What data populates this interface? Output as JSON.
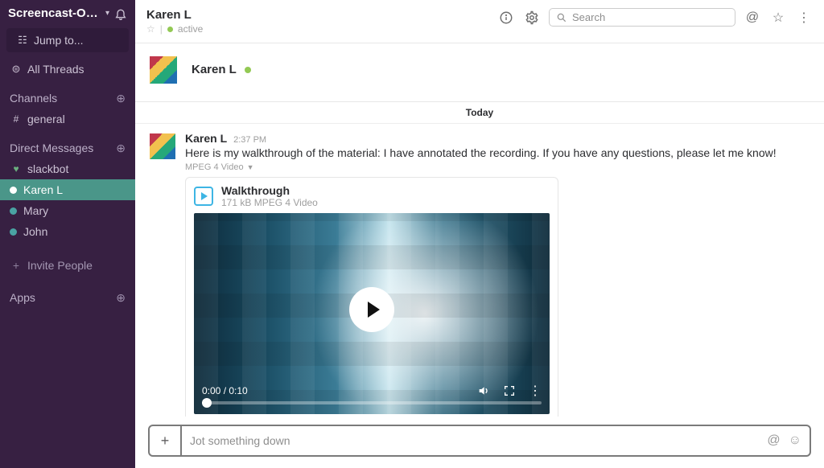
{
  "workspace": {
    "name": "Screencast-O-…"
  },
  "sidebar": {
    "jump": "Jump to...",
    "threads": "All Threads",
    "channels_label": "Channels",
    "channels": [
      {
        "name": "general"
      }
    ],
    "dm_label": "Direct Messages",
    "dms": [
      {
        "name": "slackbot",
        "presence": "heart"
      },
      {
        "name": "Karen L",
        "presence": "green",
        "selected": true
      },
      {
        "name": "Mary",
        "presence": "teal"
      },
      {
        "name": "John",
        "presence": "teal"
      }
    ],
    "invite": "Invite People",
    "apps": "Apps"
  },
  "header": {
    "title": "Karen L",
    "status": "active",
    "search_placeholder": "Search"
  },
  "conversation": {
    "name": "Karen L",
    "day_separator": "Today"
  },
  "message": {
    "author": "Karen L",
    "time": "2:37 PM",
    "text": "Here is my walkthrough of the material: I have annotated the recording. If you have any questions, please let me know!",
    "meta": "MPEG 4 Video",
    "attachment": {
      "title": "Walkthrough",
      "subtitle": "171 kB MPEG 4 Video",
      "time_display": "0:00 / 0:10"
    }
  },
  "composer": {
    "placeholder": "Jot something down"
  }
}
